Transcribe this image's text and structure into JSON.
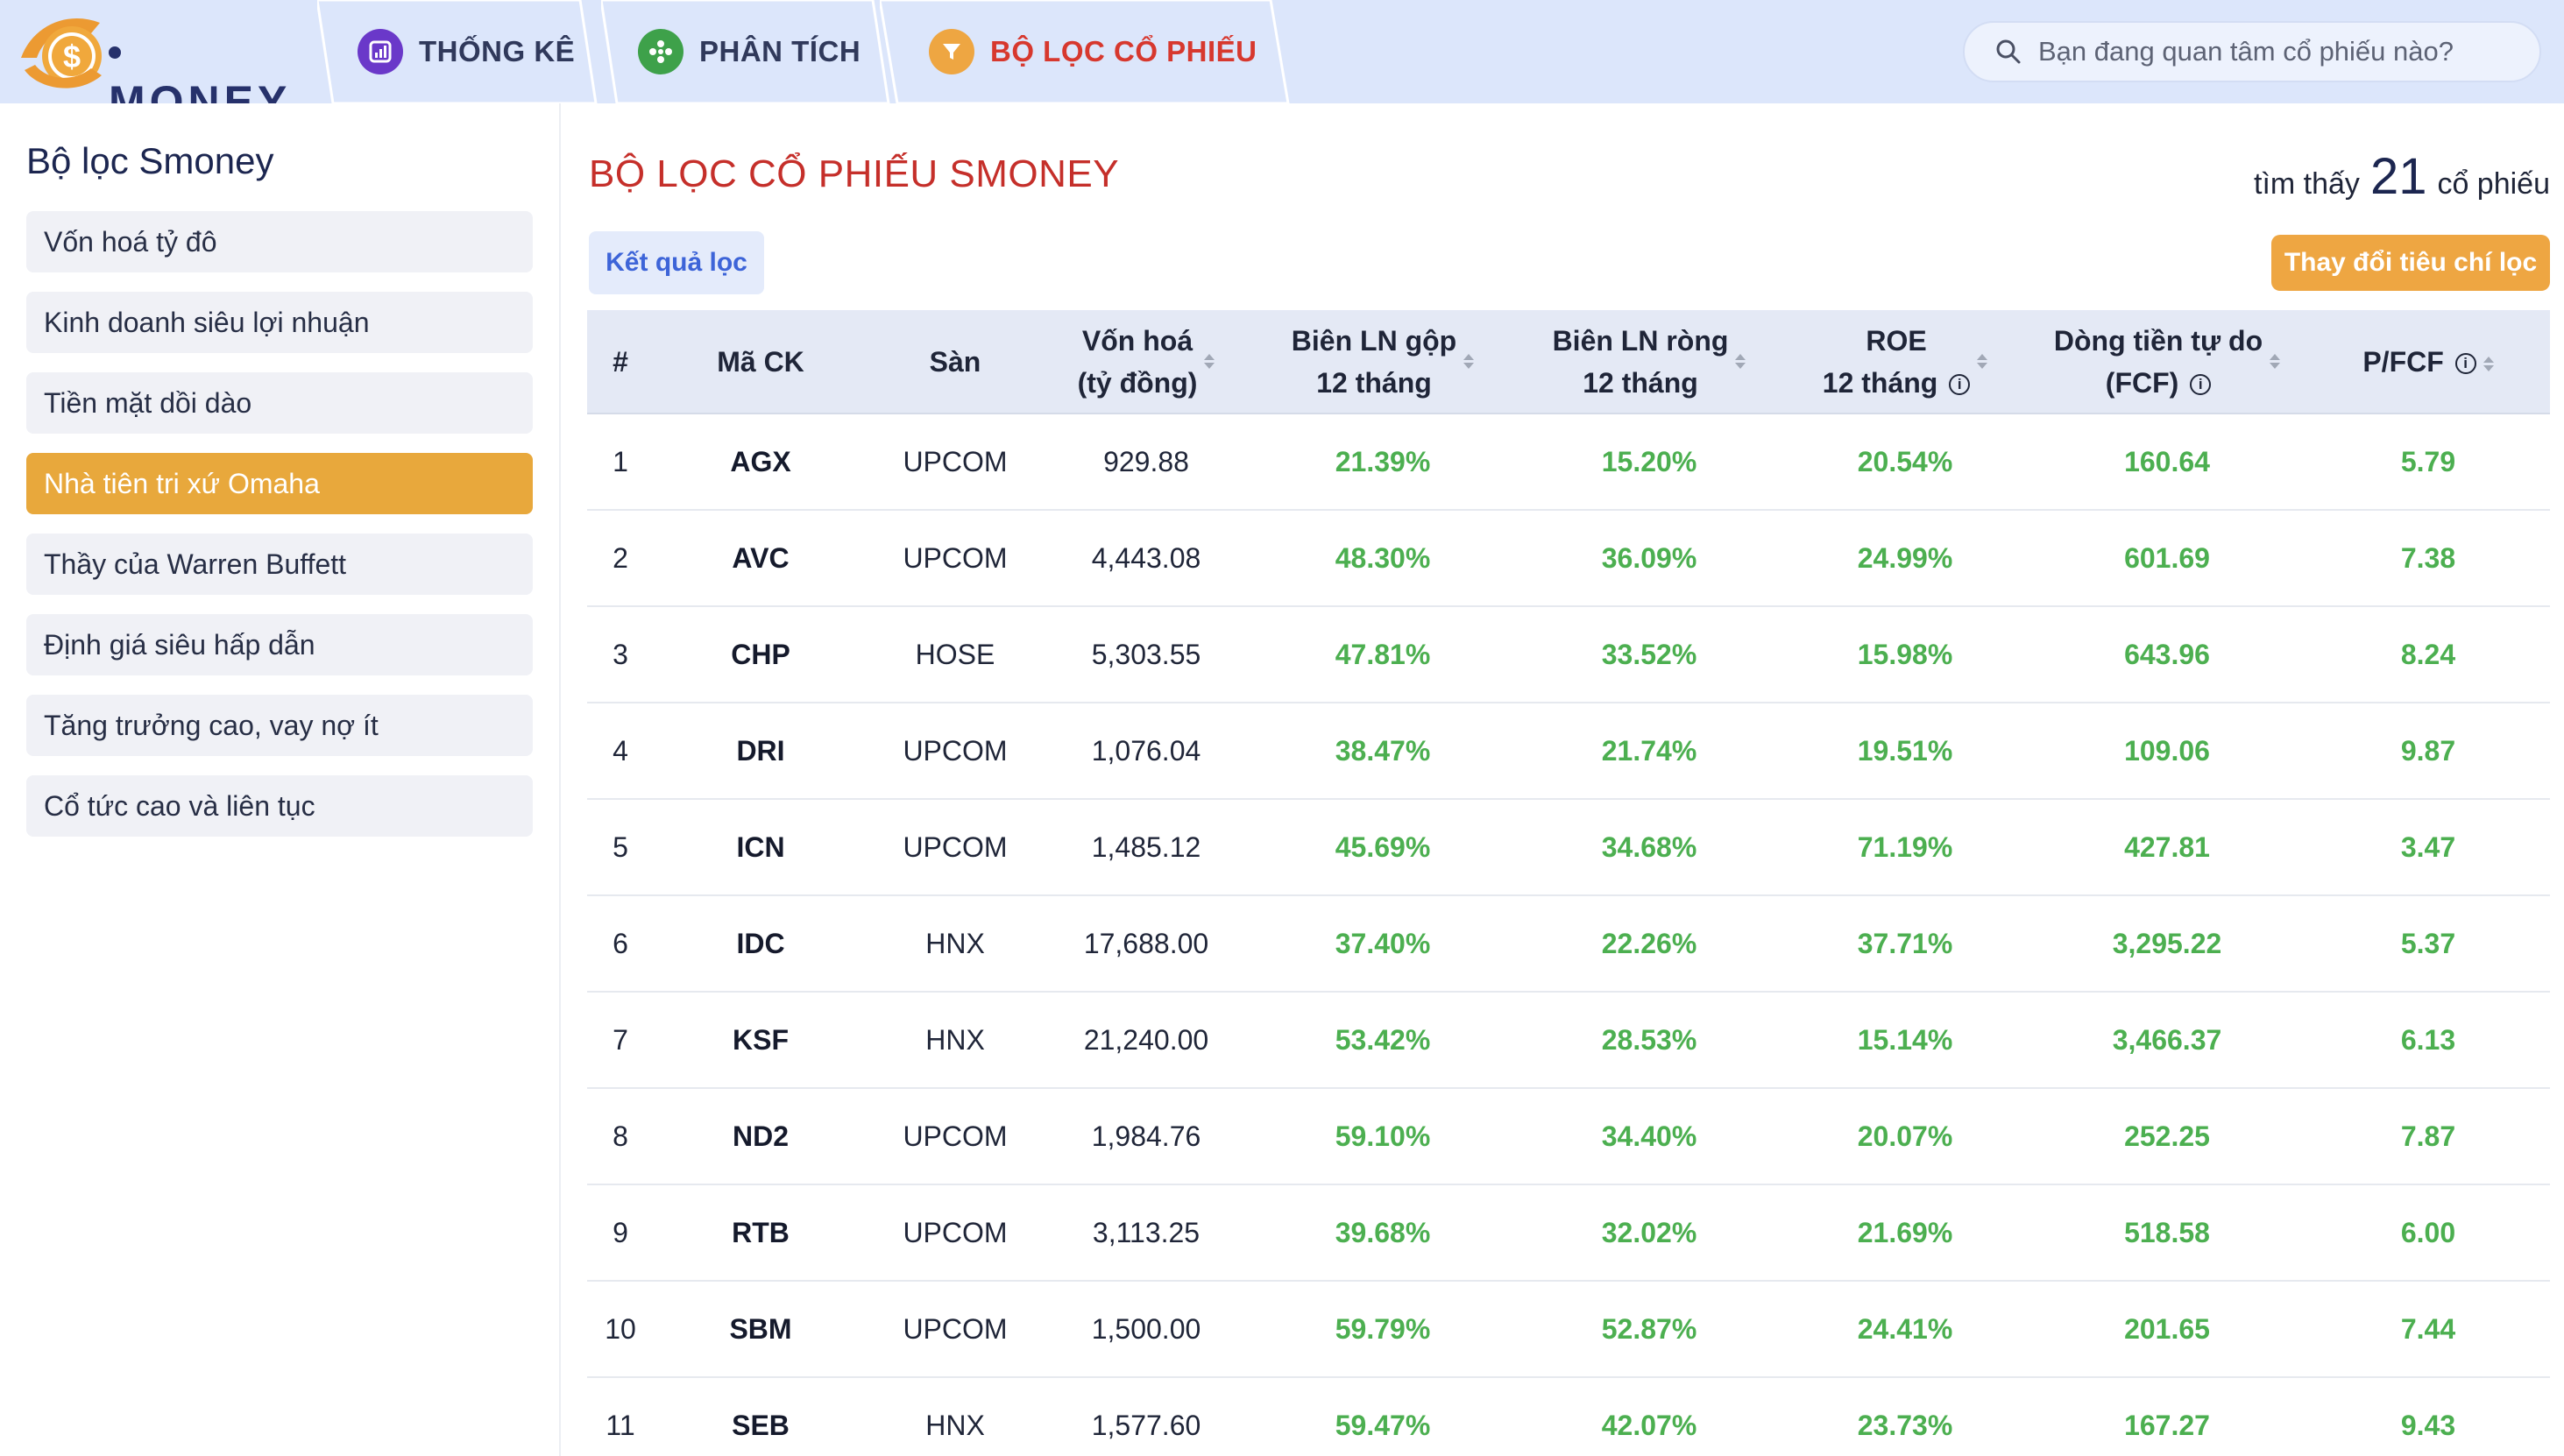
{
  "nav": {
    "logo_text": "MONEY",
    "logo_symbol": "$",
    "tabs": [
      {
        "label": "THỐNG KÊ",
        "icon": "bar-chart-icon",
        "color": "#6a38c9"
      },
      {
        "label": "PHÂN TÍCH",
        "icon": "grid-dots-icon",
        "color": "#3ea14a"
      },
      {
        "label": "BỘ LỌC CỔ PHIẾU",
        "icon": "filter-funnel-icon",
        "color": "#eea642"
      }
    ],
    "search_placeholder": "Bạn đang quan tâm cổ phiếu nào?"
  },
  "sidebar": {
    "title": "Bộ lọc Smoney",
    "items": [
      {
        "label": "Vốn hoá tỷ đô"
      },
      {
        "label": "Kinh doanh siêu lợi nhuận"
      },
      {
        "label": "Tiền mặt dồi dào"
      },
      {
        "label": "Nhà tiên tri xứ Omaha",
        "active": true
      },
      {
        "label": "Thầy của Warren Buffett"
      },
      {
        "label": "Định giá siêu hấp dẫn"
      },
      {
        "label": "Tăng trưởng cao, vay nợ ít"
      },
      {
        "label": "Cổ tức cao và liên tục"
      }
    ]
  },
  "main": {
    "title": "BỘ LỌC CỔ PHIẾU SMONEY",
    "found_prefix": "tìm thấy",
    "found_count": "21",
    "found_suffix": "cổ phiếu",
    "result_tab": "Kết quả lọc",
    "change_button": "Thay đổi tiêu chí lọc"
  },
  "table": {
    "headers": {
      "idx": "#",
      "symbol": "Mã CK",
      "exchange": "Sàn",
      "cap_1": "Vốn hoá",
      "cap_2": "(tỷ đồng)",
      "gross_1": "Biên LN gộp",
      "gross_2": "12 tháng",
      "net_1": "Biên LN ròng",
      "net_2": "12 tháng",
      "roe_1": "ROE",
      "roe_2": "12 tháng",
      "fcf_1": "Dòng tiền tự do",
      "fcf_2": "(FCF)",
      "pfcf": "P/FCF"
    },
    "rows": [
      {
        "idx": "1",
        "symbol": "AGX",
        "exchange": "UPCOM",
        "cap": "929.88",
        "gross": "21.39%",
        "net": "15.20%",
        "roe": "20.54%",
        "fcf": "160.64",
        "pfcf": "5.79"
      },
      {
        "idx": "2",
        "symbol": "AVC",
        "exchange": "UPCOM",
        "cap": "4,443.08",
        "gross": "48.30%",
        "net": "36.09%",
        "roe": "24.99%",
        "fcf": "601.69",
        "pfcf": "7.38"
      },
      {
        "idx": "3",
        "symbol": "CHP",
        "exchange": "HOSE",
        "cap": "5,303.55",
        "gross": "47.81%",
        "net": "33.52%",
        "roe": "15.98%",
        "fcf": "643.96",
        "pfcf": "8.24"
      },
      {
        "idx": "4",
        "symbol": "DRI",
        "exchange": "UPCOM",
        "cap": "1,076.04",
        "gross": "38.47%",
        "net": "21.74%",
        "roe": "19.51%",
        "fcf": "109.06",
        "pfcf": "9.87"
      },
      {
        "idx": "5",
        "symbol": "ICN",
        "exchange": "UPCOM",
        "cap": "1,485.12",
        "gross": "45.69%",
        "net": "34.68%",
        "roe": "71.19%",
        "fcf": "427.81",
        "pfcf": "3.47"
      },
      {
        "idx": "6",
        "symbol": "IDC",
        "exchange": "HNX",
        "cap": "17,688.00",
        "gross": "37.40%",
        "net": "22.26%",
        "roe": "37.71%",
        "fcf": "3,295.22",
        "pfcf": "5.37"
      },
      {
        "idx": "7",
        "symbol": "KSF",
        "exchange": "HNX",
        "cap": "21,240.00",
        "gross": "53.42%",
        "net": "28.53%",
        "roe": "15.14%",
        "fcf": "3,466.37",
        "pfcf": "6.13"
      },
      {
        "idx": "8",
        "symbol": "ND2",
        "exchange": "UPCOM",
        "cap": "1,984.76",
        "gross": "59.10%",
        "net": "34.40%",
        "roe": "20.07%",
        "fcf": "252.25",
        "pfcf": "7.87"
      },
      {
        "idx": "9",
        "symbol": "RTB",
        "exchange": "UPCOM",
        "cap": "3,113.25",
        "gross": "39.68%",
        "net": "32.02%",
        "roe": "21.69%",
        "fcf": "518.58",
        "pfcf": "6.00"
      },
      {
        "idx": "10",
        "symbol": "SBM",
        "exchange": "UPCOM",
        "cap": "1,500.00",
        "gross": "59.79%",
        "net": "52.87%",
        "roe": "24.41%",
        "fcf": "201.65",
        "pfcf": "7.44"
      },
      {
        "idx": "11",
        "symbol": "SEB",
        "exchange": "HNX",
        "cap": "1,577.60",
        "gross": "59.47%",
        "net": "42.07%",
        "roe": "23.73%",
        "fcf": "167.27",
        "pfcf": "9.43"
      }
    ]
  },
  "colors": {
    "accent_orange": "#e8a83c",
    "title_red": "#c52f2a",
    "value_green": "#4caf50",
    "nav_bg": "#dce6fb"
  }
}
